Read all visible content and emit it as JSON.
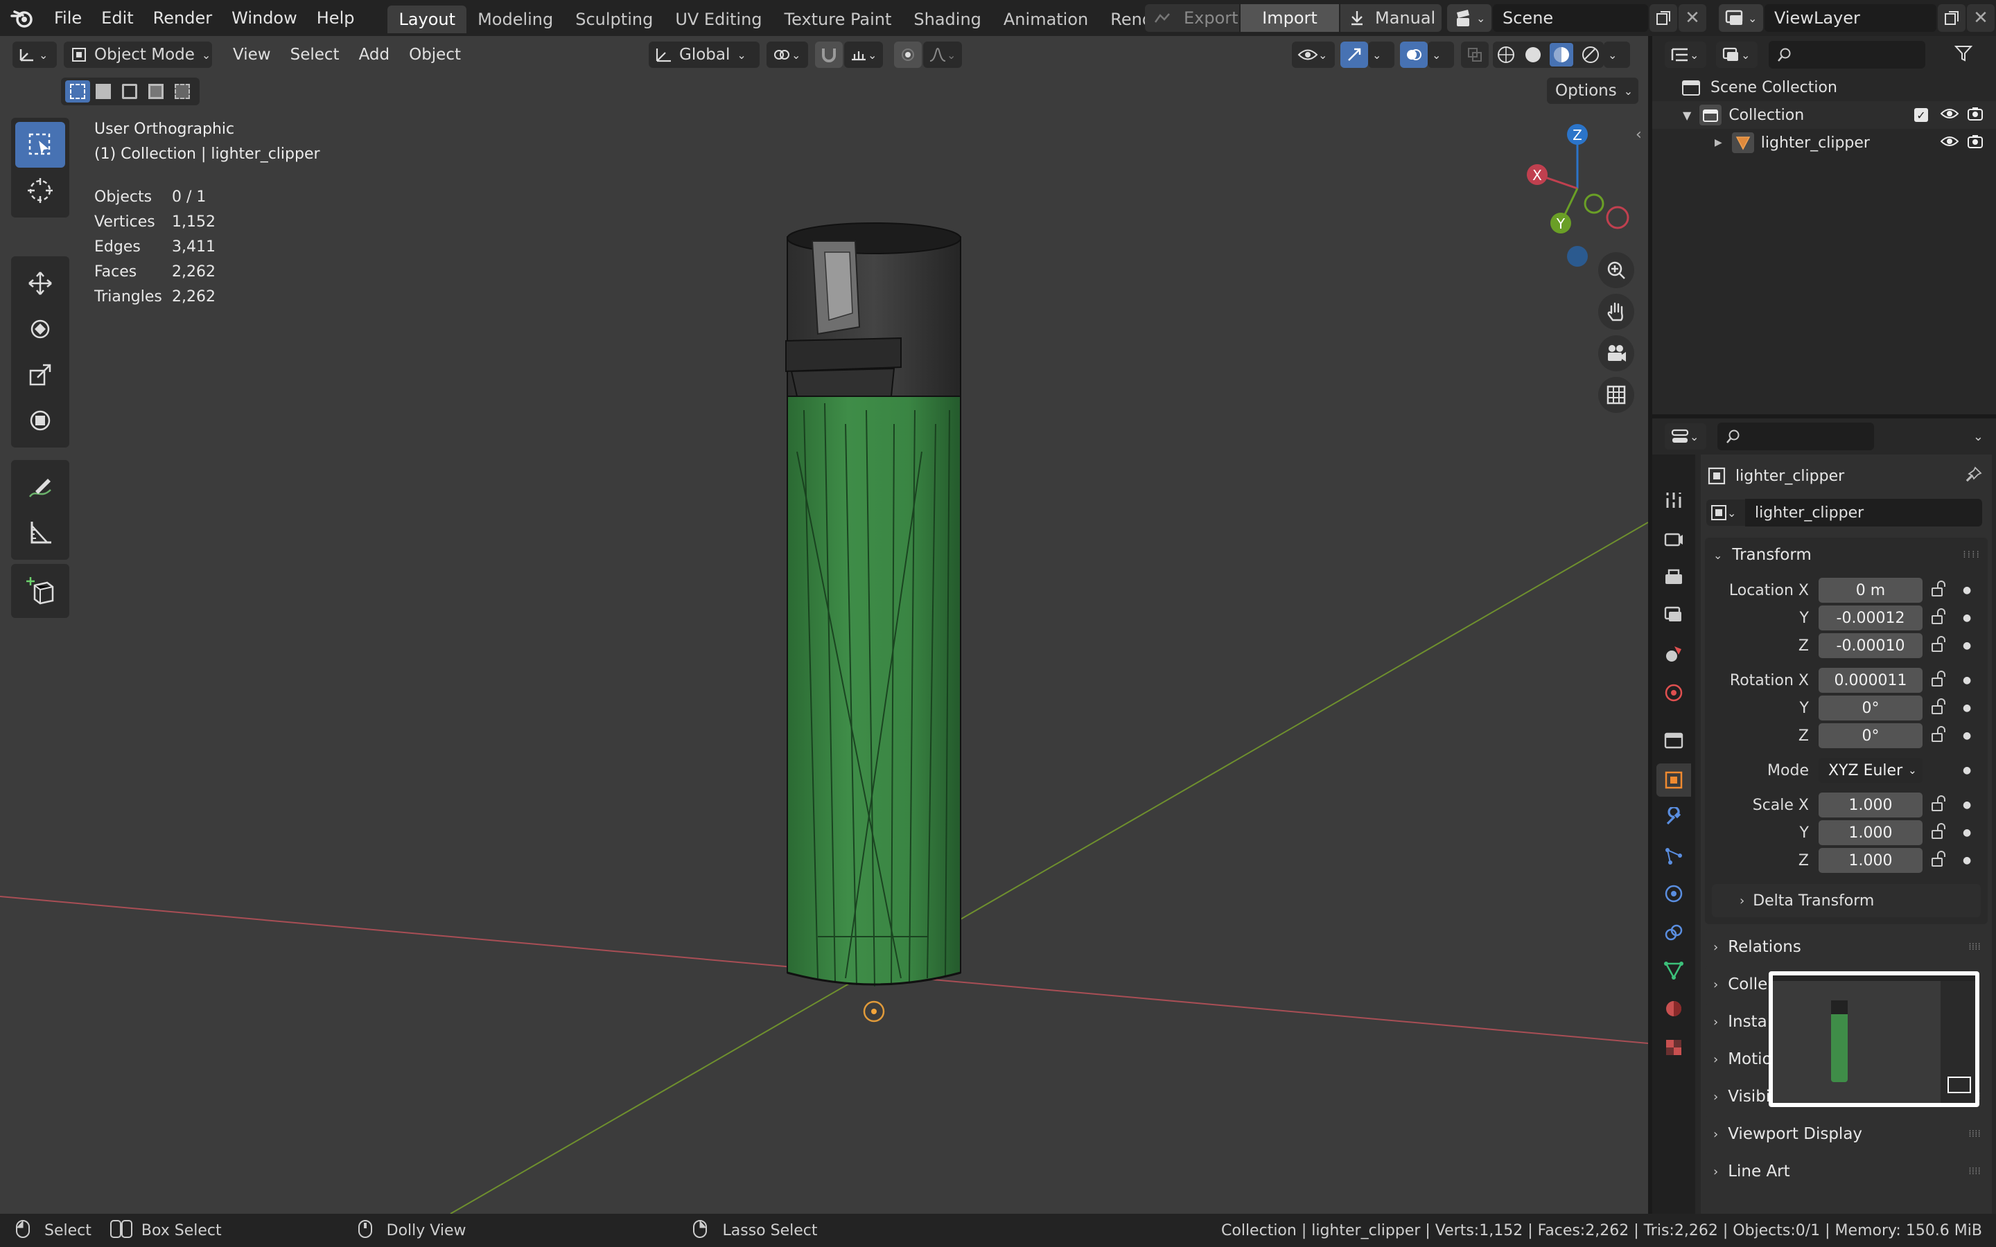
{
  "topbar": {
    "menus": [
      "File",
      "Edit",
      "Render",
      "Window",
      "Help"
    ],
    "workspaces": [
      "Layout",
      "Modeling",
      "Sculpting",
      "UV Editing",
      "Texture Paint",
      "Shading",
      "Animation",
      "Rendering"
    ],
    "active_workspace": "Layout",
    "export_label": "Export",
    "import_label": "Import",
    "manual_label": "Manual",
    "scene_name": "Scene",
    "view_layer_name": "ViewLayer"
  },
  "viewport_header": {
    "mode": "Object Mode",
    "menus": [
      "View",
      "Select",
      "Add",
      "Object"
    ],
    "orientation": "Global",
    "options_label": "Options"
  },
  "viewport_overlay": {
    "view_name": "User Orthographic",
    "collection_line": "(1) Collection | lighter_clipper",
    "stats": [
      {
        "label": "Objects",
        "value": "0 / 1"
      },
      {
        "label": "Vertices",
        "value": "1,152"
      },
      {
        "label": "Edges",
        "value": "3,411"
      },
      {
        "label": "Faces",
        "value": "2,262"
      },
      {
        "label": "Triangles",
        "value": "2,262"
      }
    ]
  },
  "gizmo": {
    "x": "X",
    "y": "Y",
    "z": "Z"
  },
  "outliner": {
    "scene_collection": "Scene Collection",
    "collection": "Collection",
    "object": "lighter_clipper"
  },
  "properties": {
    "object_name": "lighter_clipper",
    "datablock_name": "lighter_clipper",
    "transform_label": "Transform",
    "location": {
      "label": "Location X",
      "x": "0 m",
      "y": "-0.00012",
      "z": "-0.00010"
    },
    "rotation": {
      "label": "Rotation X",
      "x": "0.000011",
      "y": "0°",
      "z": "0°"
    },
    "mode": {
      "label": "Mode",
      "value": "XYZ Euler"
    },
    "scale": {
      "label": "Scale X",
      "x": "1.000",
      "y": "1.000",
      "z": "1.000"
    },
    "axis_y": "Y",
    "axis_z": "Z",
    "delta_transform": "Delta Transform",
    "panels": [
      "Relations",
      "Collections",
      "Instancing",
      "Motion Paths",
      "Visibility",
      "Viewport Display",
      "Line Art"
    ],
    "panels_visible": [
      "Relations",
      "Colle",
      "Insta",
      "Motio",
      "Visibility",
      "Viewport Display",
      "Line Art"
    ]
  },
  "statusbar": {
    "select": "Select",
    "box_select": "Box Select",
    "dolly_view": "Dolly View",
    "lasso_select": "Lasso Select",
    "info": "Collection | lighter_clipper | Verts:1,152 | Faces:2,262 | Tris:2,262 | Objects:0/1 | Memory: 150.6 MiB"
  },
  "colors": {
    "accent": "#4772b3",
    "x_axis": "#b8464f",
    "y_axis": "#6a8f2a",
    "z_axis": "#2b74c9",
    "lighter": "#3c8a45"
  }
}
